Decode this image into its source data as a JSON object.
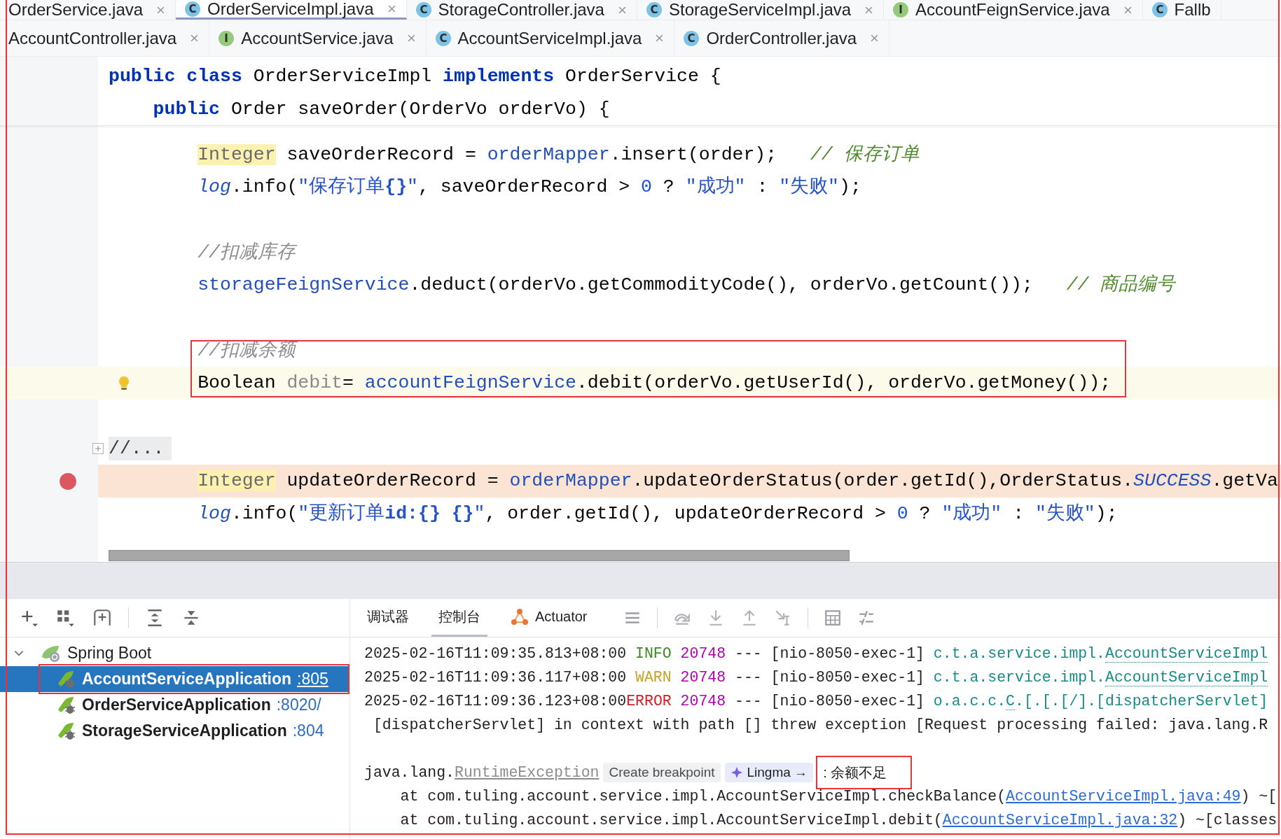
{
  "annotation_frame": true,
  "tab_rows": [
    [
      {
        "label": "OrderService.java",
        "selected": false
      },
      {
        "label": "OrderServiceImpl.java",
        "selected": true,
        "kind": "class",
        "icon": "C"
      },
      {
        "label": "StorageController.java",
        "selected": false,
        "kind": "class",
        "icon": "C"
      },
      {
        "label": "StorageServiceImpl.java",
        "selected": false,
        "kind": "class",
        "icon": "C"
      },
      {
        "label": "AccountFeignService.java",
        "selected": false,
        "kind": "interface",
        "icon": "I"
      },
      {
        "label": "Fallb",
        "selected": false,
        "kind": "class",
        "icon": "C"
      }
    ],
    [
      {
        "label": "AccountController.java",
        "selected": false
      },
      {
        "label": "AccountService.java",
        "selected": false,
        "kind": "interface",
        "icon": "I"
      },
      {
        "label": "AccountServiceImpl.java",
        "selected": false,
        "kind": "class",
        "icon": "C"
      },
      {
        "label": "OrderController.java",
        "selected": false,
        "kind": "class",
        "icon": "C"
      }
    ]
  ],
  "code": {
    "sticky_lines": [
      {
        "kind": "plain",
        "tokens": [
          {
            "kind": "kw",
            "text": "public class"
          },
          {
            "kind": "plain",
            "text": " OrderServiceImpl "
          },
          {
            "kind": "kw",
            "text": "implements"
          },
          {
            "kind": "plain",
            "text": " OrderService {"
          }
        ],
        "children": [
          {
            "kind": "plain",
            "tokens": [
              {
                "kind": "kw",
                "text": "public"
              },
              {
                "kind": "plain",
                "text": " Order saveOrder(OrderVo orderVo) {"
              }
            ]
          }
        ]
      }
    ],
    "lines": [
      {
        "children": [
          {
            "children": [
              {
                "kind": "plain",
                "tokens": [
                  {
                    "kind": "type_hl",
                    "text": "Integer"
                  },
                  {
                    "kind": "plain",
                    "text": " saveOrderRecord = "
                  },
                  {
                    "kind": "field",
                    "text": "orderMapper"
                  },
                  {
                    "kind": "plain",
                    "text": ".insert(order);   "
                  },
                  {
                    "kind": "doc",
                    "text": "// 保存订单"
                  }
                ]
              },
              {
                "kind": "plain",
                "tokens": [
                  {
                    "kind": "field_italic",
                    "text": "log"
                  },
                  {
                    "kind": "plain",
                    "text": ".info("
                  },
                  {
                    "kind": "str",
                    "text": "\"保存订单"
                  },
                  {
                    "kind": "str_bold",
                    "text": "{}"
                  },
                  {
                    "kind": "str",
                    "text": "\""
                  },
                  {
                    "kind": "plain",
                    "text": ", saveOrderRecord > "
                  },
                  {
                    "kind": "num",
                    "text": "0"
                  },
                  {
                    "kind": "plain",
                    "text": " ? "
                  },
                  {
                    "kind": "str",
                    "text": "\"成功\""
                  },
                  {
                    "kind": "plain",
                    "text": " : "
                  },
                  {
                    "kind": "str",
                    "text": "\"失败\""
                  },
                  {
                    "kind": "plain",
                    "text": ");"
                  }
                ]
              },
              {
                "kind": "blank"
              },
              {
                "kind": "plain",
                "tokens": [
                  {
                    "kind": "comment",
                    "text": "//扣减库存"
                  }
                ]
              },
              {
                "kind": "plain",
                "tokens": [
                  {
                    "kind": "field",
                    "text": "storageFeignService"
                  },
                  {
                    "kind": "plain",
                    "text": ".deduct(orderVo.getCommodityCode(), orderVo.getCount());   "
                  },
                  {
                    "kind": "doc",
                    "text": "// 商品编号"
                  }
                ]
              },
              {
                "kind": "blank"
              },
              {
                "kind": "plain",
                "boxed": true,
                "tokens": [
                  {
                    "kind": "comment",
                    "text": "//扣减余额"
                  }
                ]
              },
              {
                "kind": "caret",
                "boxed": true,
                "intention_bulb": true,
                "tokens": [
                  {
                    "kind": "plain",
                    "text": "Boolean "
                  },
                  {
                    "kind": "unused",
                    "text": "debit"
                  },
                  {
                    "kind": "plain",
                    "text": "= "
                  },
                  {
                    "kind": "field",
                    "text": "accountFeignService"
                  },
                  {
                    "kind": "plain",
                    "text": ".debit(orderVo.getUserId(), orderVo.getMoney());"
                  }
                ]
              },
              {
                "kind": "blank"
              }
            ]
          }
        ]
      },
      {
        "kind": "folded",
        "tokens": [
          {
            "kind": "plain",
            "text": "//..."
          }
        ]
      },
      {
        "children": [
          {
            "children": [
              {
                "kind": "breakpoint",
                "tokens": [
                  {
                    "kind": "type_hl",
                    "text": "Integer"
                  },
                  {
                    "kind": "plain",
                    "text": " updateOrderRecord = "
                  },
                  {
                    "kind": "field",
                    "text": "orderMapper"
                  },
                  {
                    "kind": "plain",
                    "text": ".updateOrderStatus(order.getId(),OrderStatus."
                  },
                  {
                    "kind": "static_italic",
                    "text": "SUCCESS"
                  },
                  {
                    "kind": "plain",
                    "text": ".getVa"
                  }
                ]
              },
              {
                "kind": "plain",
                "tokens": [
                  {
                    "kind": "field_italic",
                    "text": "log"
                  },
                  {
                    "kind": "plain",
                    "text": ".info("
                  },
                  {
                    "kind": "str",
                    "text": "\"更新订单"
                  },
                  {
                    "kind": "str_bold",
                    "text": "id:{} {}"
                  },
                  {
                    "kind": "str",
                    "text": "\""
                  },
                  {
                    "kind": "plain",
                    "text": ", order.getId(), updateOrderRecord > "
                  },
                  {
                    "kind": "num",
                    "text": "0"
                  },
                  {
                    "kind": "plain",
                    "text": " ? "
                  },
                  {
                    "kind": "str",
                    "text": "\"成功\""
                  },
                  {
                    "kind": "plain",
                    "text": " : "
                  },
                  {
                    "kind": "str",
                    "text": "\"失败\""
                  },
                  {
                    "kind": "plain",
                    "text": ");"
                  }
                ]
              }
            ]
          }
        ]
      }
    ]
  },
  "services": {
    "root": {
      "label": "Spring Boot",
      "expanded": true,
      "children": [
        {
          "label": "AccountServiceApplication",
          "port": ":805",
          "selected": true,
          "boxed": true
        },
        {
          "label": "OrderServiceApplication",
          "port": ":8020/",
          "selected": false
        },
        {
          "label": "StorageServiceApplication",
          "port": ":804",
          "selected": false
        }
      ]
    }
  },
  "console": {
    "tabs": [
      {
        "label": "调试器",
        "selected": false
      },
      {
        "label": "控制台",
        "selected": true
      },
      {
        "label": "Actuator",
        "selected": false
      }
    ],
    "lines": [
      {
        "kind": "log",
        "time": "2025-02-16T11:09:35.813+08:00",
        "level": "INFO",
        "color": "#3c8c22",
        "pid": "20748",
        "thread": "--- [nio-8050-exec-1]",
        "logger": "c.t.a.service.impl.",
        "logger_link": "AccountServiceImpl"
      },
      {
        "kind": "log",
        "time": "2025-02-16T11:09:36.117+08:00",
        "level": "WARN",
        "color": "#c7a12a",
        "pid": "20748",
        "thread": "--- [nio-8050-exec-1]",
        "logger": "c.t.a.service.impl.",
        "logger_link": "AccountServiceImpl"
      },
      {
        "kind": "log",
        "time": "2025-02-16T11:09:36.123+08:00",
        "level": "ERROR",
        "color": "#d0202a",
        "pid": "20748",
        "thread": "--- [nio-8050-exec-1]",
        "logger": "o.a.c.c.",
        "logger_link": "C",
        "logger_rest": ".[.[.[/].[dispatcherServlet]"
      },
      {
        "kind": "text",
        "text": " [dispatcherServlet] in context with path [] threw exception [Request processing failed: java.lang.R"
      },
      {
        "kind": "blank"
      },
      {
        "kind": "exception",
        "prefix": "java.lang.",
        "link": "RuntimeException",
        "actions": [
          {
            "label": "Create breakpoint"
          },
          {
            "label": "Lingma →"
          }
        ],
        "message": ": 余额不足",
        "boxed": true
      },
      {
        "kind": "stack",
        "prefix": "    at com.tuling.account.service.impl.AccountServiceImpl.checkBalance(",
        "link": "AccountServiceImpl.java:49",
        "suffix": ") ~["
      },
      {
        "kind": "stack",
        "prefix": "    at com.tuling.account.service.impl.AccountServiceImpl.debit(",
        "link": "AccountServiceImpl.java:32",
        "suffix": ") ~[classes"
      }
    ]
  }
}
